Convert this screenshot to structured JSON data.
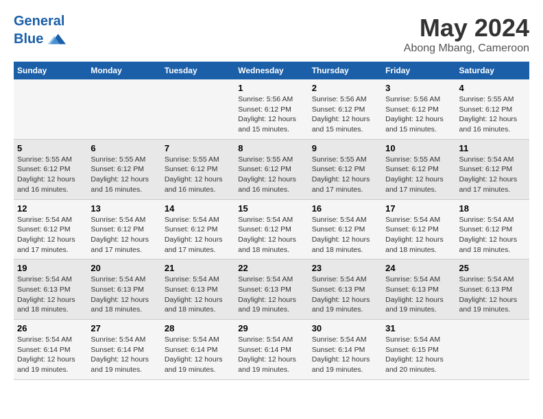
{
  "header": {
    "logo_line1": "General",
    "logo_line2": "Blue",
    "month_year": "May 2024",
    "location": "Abong Mbang, Cameroon"
  },
  "weekdays": [
    "Sunday",
    "Monday",
    "Tuesday",
    "Wednesday",
    "Thursday",
    "Friday",
    "Saturday"
  ],
  "rows": [
    [
      {
        "day": "",
        "info": ""
      },
      {
        "day": "",
        "info": ""
      },
      {
        "day": "",
        "info": ""
      },
      {
        "day": "1",
        "info": "Sunrise: 5:56 AM\nSunset: 6:12 PM\nDaylight: 12 hours\nand 15 minutes."
      },
      {
        "day": "2",
        "info": "Sunrise: 5:56 AM\nSunset: 6:12 PM\nDaylight: 12 hours\nand 15 minutes."
      },
      {
        "day": "3",
        "info": "Sunrise: 5:56 AM\nSunset: 6:12 PM\nDaylight: 12 hours\nand 15 minutes."
      },
      {
        "day": "4",
        "info": "Sunrise: 5:55 AM\nSunset: 6:12 PM\nDaylight: 12 hours\nand 16 minutes."
      }
    ],
    [
      {
        "day": "5",
        "info": "Sunrise: 5:55 AM\nSunset: 6:12 PM\nDaylight: 12 hours\nand 16 minutes."
      },
      {
        "day": "6",
        "info": "Sunrise: 5:55 AM\nSunset: 6:12 PM\nDaylight: 12 hours\nand 16 minutes."
      },
      {
        "day": "7",
        "info": "Sunrise: 5:55 AM\nSunset: 6:12 PM\nDaylight: 12 hours\nand 16 minutes."
      },
      {
        "day": "8",
        "info": "Sunrise: 5:55 AM\nSunset: 6:12 PM\nDaylight: 12 hours\nand 16 minutes."
      },
      {
        "day": "9",
        "info": "Sunrise: 5:55 AM\nSunset: 6:12 PM\nDaylight: 12 hours\nand 17 minutes."
      },
      {
        "day": "10",
        "info": "Sunrise: 5:55 AM\nSunset: 6:12 PM\nDaylight: 12 hours\nand 17 minutes."
      },
      {
        "day": "11",
        "info": "Sunrise: 5:54 AM\nSunset: 6:12 PM\nDaylight: 12 hours\nand 17 minutes."
      }
    ],
    [
      {
        "day": "12",
        "info": "Sunrise: 5:54 AM\nSunset: 6:12 PM\nDaylight: 12 hours\nand 17 minutes."
      },
      {
        "day": "13",
        "info": "Sunrise: 5:54 AM\nSunset: 6:12 PM\nDaylight: 12 hours\nand 17 minutes."
      },
      {
        "day": "14",
        "info": "Sunrise: 5:54 AM\nSunset: 6:12 PM\nDaylight: 12 hours\nand 17 minutes."
      },
      {
        "day": "15",
        "info": "Sunrise: 5:54 AM\nSunset: 6:12 PM\nDaylight: 12 hours\nand 18 minutes."
      },
      {
        "day": "16",
        "info": "Sunrise: 5:54 AM\nSunset: 6:12 PM\nDaylight: 12 hours\nand 18 minutes."
      },
      {
        "day": "17",
        "info": "Sunrise: 5:54 AM\nSunset: 6:12 PM\nDaylight: 12 hours\nand 18 minutes."
      },
      {
        "day": "18",
        "info": "Sunrise: 5:54 AM\nSunset: 6:12 PM\nDaylight: 12 hours\nand 18 minutes."
      }
    ],
    [
      {
        "day": "19",
        "info": "Sunrise: 5:54 AM\nSunset: 6:13 PM\nDaylight: 12 hours\nand 18 minutes."
      },
      {
        "day": "20",
        "info": "Sunrise: 5:54 AM\nSunset: 6:13 PM\nDaylight: 12 hours\nand 18 minutes."
      },
      {
        "day": "21",
        "info": "Sunrise: 5:54 AM\nSunset: 6:13 PM\nDaylight: 12 hours\nand 18 minutes."
      },
      {
        "day": "22",
        "info": "Sunrise: 5:54 AM\nSunset: 6:13 PM\nDaylight: 12 hours\nand 19 minutes."
      },
      {
        "day": "23",
        "info": "Sunrise: 5:54 AM\nSunset: 6:13 PM\nDaylight: 12 hours\nand 19 minutes."
      },
      {
        "day": "24",
        "info": "Sunrise: 5:54 AM\nSunset: 6:13 PM\nDaylight: 12 hours\nand 19 minutes."
      },
      {
        "day": "25",
        "info": "Sunrise: 5:54 AM\nSunset: 6:13 PM\nDaylight: 12 hours\nand 19 minutes."
      }
    ],
    [
      {
        "day": "26",
        "info": "Sunrise: 5:54 AM\nSunset: 6:14 PM\nDaylight: 12 hours\nand 19 minutes."
      },
      {
        "day": "27",
        "info": "Sunrise: 5:54 AM\nSunset: 6:14 PM\nDaylight: 12 hours\nand 19 minutes."
      },
      {
        "day": "28",
        "info": "Sunrise: 5:54 AM\nSunset: 6:14 PM\nDaylight: 12 hours\nand 19 minutes."
      },
      {
        "day": "29",
        "info": "Sunrise: 5:54 AM\nSunset: 6:14 PM\nDaylight: 12 hours\nand 19 minutes."
      },
      {
        "day": "30",
        "info": "Sunrise: 5:54 AM\nSunset: 6:14 PM\nDaylight: 12 hours\nand 19 minutes."
      },
      {
        "day": "31",
        "info": "Sunrise: 5:54 AM\nSunset: 6:15 PM\nDaylight: 12 hours\nand 20 minutes."
      },
      {
        "day": "",
        "info": ""
      }
    ]
  ]
}
